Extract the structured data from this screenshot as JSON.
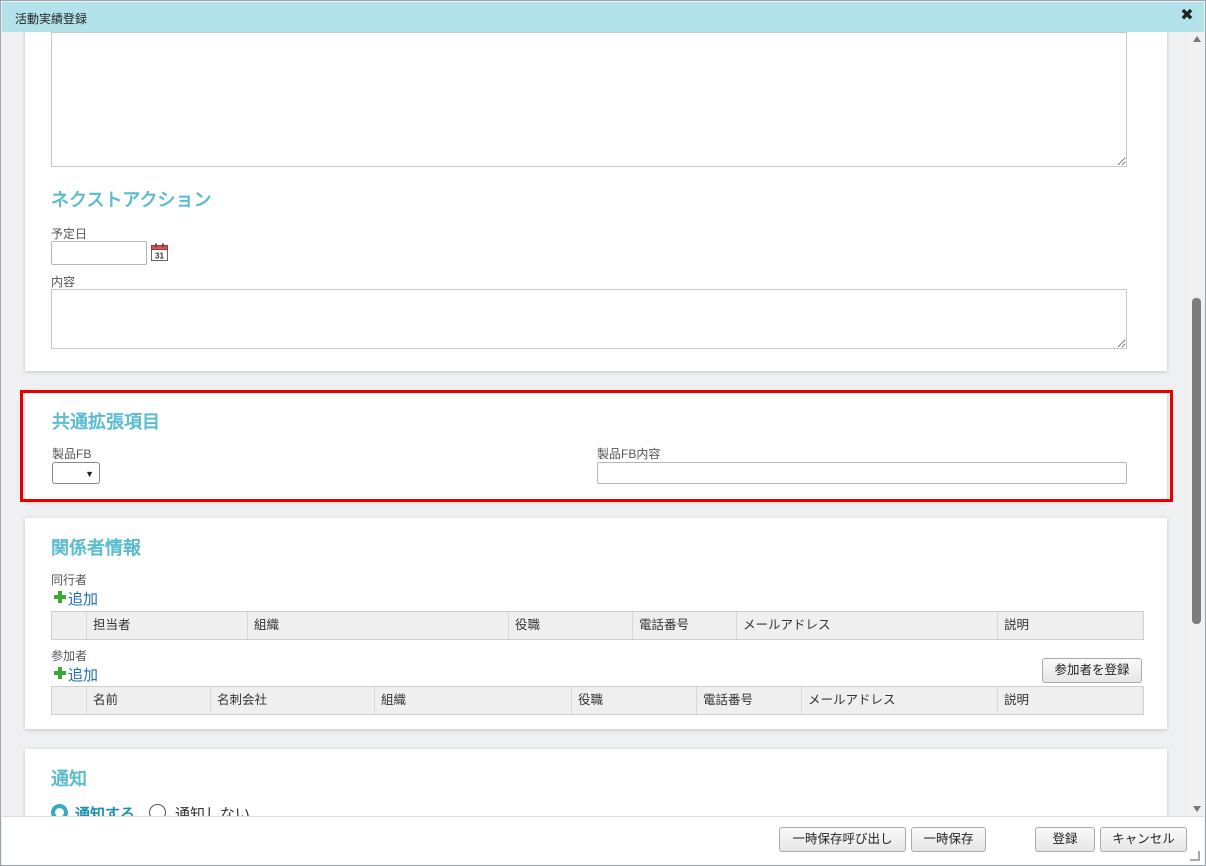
{
  "window": {
    "title": "活動実績登録",
    "close": "✖"
  },
  "next_action": {
    "title": "ネクストアクション",
    "date_label": "予定日",
    "date_value": "",
    "content_label": "内容"
  },
  "common_ext": {
    "title": "共通拡張項目",
    "product_fb_label": "製品FB",
    "product_fb_value": "",
    "product_fb_content_label": "製品FB内容",
    "product_fb_content_value": ""
  },
  "related": {
    "title": "関係者情報",
    "companions_label": "同行者",
    "add_label": "追加",
    "companion_columns": [
      "担当者",
      "組織",
      "役職",
      "電話番号",
      "メールアドレス",
      "説明"
    ],
    "participants_label": "参加者",
    "register_participant": "参加者を登録",
    "participant_columns": [
      "名前",
      "名刺会社",
      "組織",
      "役職",
      "電話番号",
      "メールアドレス",
      "説明"
    ]
  },
  "notify": {
    "title": "通知",
    "options": [
      {
        "label": "通知する",
        "selected": true
      },
      {
        "label": "通知しない",
        "selected": false
      }
    ]
  },
  "footer": {
    "recall_temp": "一時保存呼び出し",
    "temp_save": "一時保存",
    "register": "登録",
    "cancel": "キャンセル"
  },
  "colors": {
    "accent": "#5bbcd0",
    "titlebar": "#b2e3eb",
    "highlight": "#e60000",
    "link": "#1f6fb5"
  }
}
